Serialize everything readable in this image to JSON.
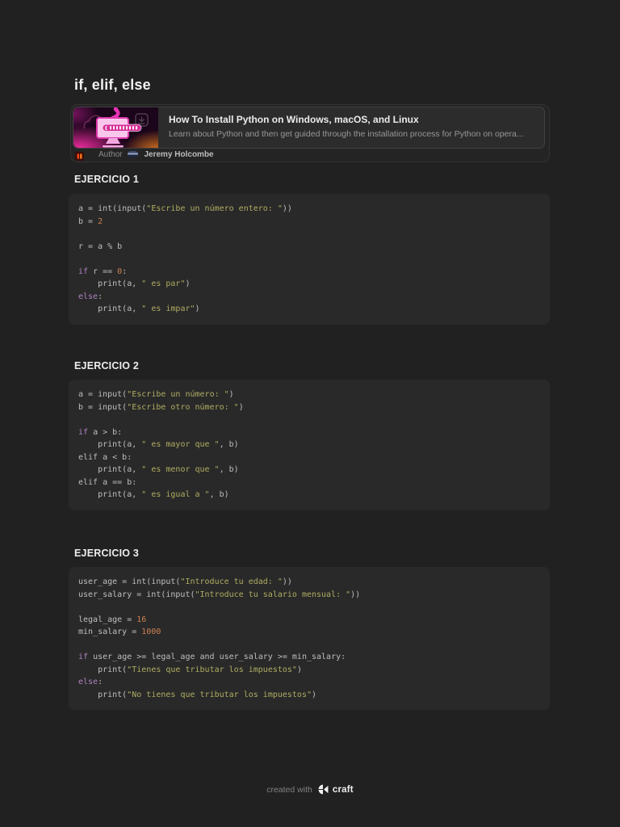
{
  "page": {
    "title": "if, elif, else"
  },
  "link_card": {
    "title": "How To Install Python on Windows, macOS, and Linux",
    "description": "Learn about Python and then get guided through the installation process for Python on opera...",
    "author_label": "Author",
    "author_name": "Jeremy Holcombe",
    "thumbnail_icon": "python-install-illustration",
    "site_icon": "red-bars-favicon",
    "avatar_icon": "author-avatar"
  },
  "sections": [
    {
      "heading": "EJERCICIO 1",
      "code_lines": [
        [
          {
            "t": "d",
            "x": "a = int(input("
          },
          {
            "t": "s",
            "x": "\"Escribe un número entero: \""
          },
          {
            "t": "d",
            "x": "))"
          }
        ],
        [
          {
            "t": "d",
            "x": "b = "
          },
          {
            "t": "n",
            "x": "2"
          }
        ],
        [],
        [
          {
            "t": "d",
            "x": "r = a % b"
          }
        ],
        [],
        [
          {
            "t": "k",
            "x": "if"
          },
          {
            "t": "d",
            "x": " r == "
          },
          {
            "t": "n",
            "x": "0"
          },
          {
            "t": "d",
            "x": ":"
          }
        ],
        [
          {
            "t": "d",
            "x": "    print(a, "
          },
          {
            "t": "s",
            "x": "\" es par\""
          },
          {
            "t": "d",
            "x": ")"
          }
        ],
        [
          {
            "t": "k",
            "x": "else"
          },
          {
            "t": "d",
            "x": ":"
          }
        ],
        [
          {
            "t": "d",
            "x": "    print(a, "
          },
          {
            "t": "s",
            "x": "\" es impar\""
          },
          {
            "t": "d",
            "x": ")"
          }
        ]
      ]
    },
    {
      "heading": "EJERCICIO 2",
      "code_lines": [
        [
          {
            "t": "d",
            "x": "a = input("
          },
          {
            "t": "s",
            "x": "\"Escribe un número: \""
          },
          {
            "t": "d",
            "x": ")"
          }
        ],
        [
          {
            "t": "d",
            "x": "b = input("
          },
          {
            "t": "s",
            "x": "\"Escribe otro número: \""
          },
          {
            "t": "d",
            "x": ")"
          }
        ],
        [],
        [
          {
            "t": "k",
            "x": "if"
          },
          {
            "t": "d",
            "x": " a > b:"
          }
        ],
        [
          {
            "t": "d",
            "x": "    print(a, "
          },
          {
            "t": "s",
            "x": "\" es mayor que \""
          },
          {
            "t": "d",
            "x": ", b)"
          }
        ],
        [
          {
            "t": "d",
            "x": "elif a < b:"
          }
        ],
        [
          {
            "t": "d",
            "x": "    print(a, "
          },
          {
            "t": "s",
            "x": "\" es menor que \""
          },
          {
            "t": "d",
            "x": ", b)"
          }
        ],
        [
          {
            "t": "d",
            "x": "elif a == b:"
          }
        ],
        [
          {
            "t": "d",
            "x": "    print(a, "
          },
          {
            "t": "s",
            "x": "\" es igual a \""
          },
          {
            "t": "d",
            "x": ", b)"
          }
        ]
      ]
    },
    {
      "heading": "EJERCICIO 3",
      "code_lines": [
        [
          {
            "t": "d",
            "x": "user_age = int(input("
          },
          {
            "t": "s",
            "x": "\"Introduce tu edad: \""
          },
          {
            "t": "d",
            "x": "))"
          }
        ],
        [
          {
            "t": "d",
            "x": "user_salary = int(input("
          },
          {
            "t": "s",
            "x": "\"Introduce tu salario mensual: \""
          },
          {
            "t": "d",
            "x": "))"
          }
        ],
        [],
        [
          {
            "t": "d",
            "x": "legal_age = "
          },
          {
            "t": "n",
            "x": "16"
          }
        ],
        [
          {
            "t": "d",
            "x": "min_salary = "
          },
          {
            "t": "n",
            "x": "1000"
          }
        ],
        [],
        [
          {
            "t": "k",
            "x": "if"
          },
          {
            "t": "d",
            "x": " user_age >= legal_age and user_salary >= min_salary:"
          }
        ],
        [
          {
            "t": "d",
            "x": "    print("
          },
          {
            "t": "s",
            "x": "\"Tienes que tributar los impuestos\""
          },
          {
            "t": "d",
            "x": ")"
          }
        ],
        [
          {
            "t": "k",
            "x": "else"
          },
          {
            "t": "d",
            "x": ":"
          }
        ],
        [
          {
            "t": "d",
            "x": "    print("
          },
          {
            "t": "s",
            "x": "\"No tienes que tributar los impuestos\""
          },
          {
            "t": "d",
            "x": ")"
          }
        ]
      ]
    }
  ],
  "footer": {
    "created_with": "created with",
    "brand": "craft"
  },
  "colors": {
    "page_bg": "#212121",
    "block_bg": "#292929",
    "card_bg": "#242424",
    "panel_bg": "#2c2c2c",
    "card_border": "#333333",
    "panel_border": "#414141",
    "heading": "#ededed",
    "code_default": "#bfbfbf",
    "code_string": "#aeac62",
    "code_number": "#cd8153",
    "code_keyword": "#b183c2",
    "text_dim": "#8c8c8c",
    "text_name": "#bdbdbd",
    "footer_dim": "#818181",
    "accent_magenta": "#e032a8",
    "accent_orange": "#ff7a1f"
  }
}
